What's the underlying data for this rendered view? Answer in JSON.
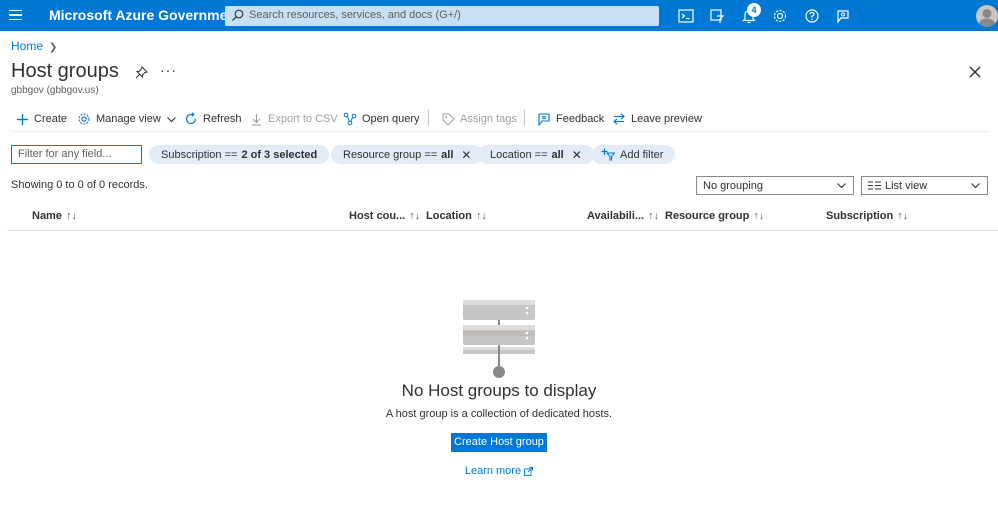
{
  "topbar": {
    "brand": "Microsoft Azure Government",
    "search_placeholder": "Search resources, services, and docs (G+/)",
    "notification_count": "4",
    "accent": "#0078d4"
  },
  "breadcrumb": {
    "home": "Home"
  },
  "page": {
    "title": "Host groups",
    "subtitle": "gbbgov (gbbgov.us)"
  },
  "commands": {
    "create": "Create",
    "manage_view": "Manage view",
    "refresh": "Refresh",
    "export_csv": "Export to CSV",
    "open_query": "Open query",
    "assign_tags": "Assign tags",
    "feedback": "Feedback",
    "leave_preview": "Leave preview"
  },
  "filters": {
    "placeholder": "Filter for any field...",
    "subscription_label": "Subscription ==",
    "subscription_value": "2 of 3 selected",
    "resource_group_label": "Resource group ==",
    "resource_group_value": "all",
    "location_label": "Location ==",
    "location_value": "all",
    "add_filter": "Add filter"
  },
  "records": "Showing 0 to 0 of 0 records.",
  "grouping": "No grouping",
  "view": "List view",
  "columns": {
    "name": "Name",
    "host_count": "Host cou...",
    "location": "Location",
    "availability": "Availabili...",
    "resource_group": "Resource group",
    "subscription": "Subscription"
  },
  "empty": {
    "title": "No Host groups to display",
    "description": "A host group is a collection of dedicated hosts.",
    "create_button": "Create Host group",
    "learn_more": "Learn more"
  }
}
